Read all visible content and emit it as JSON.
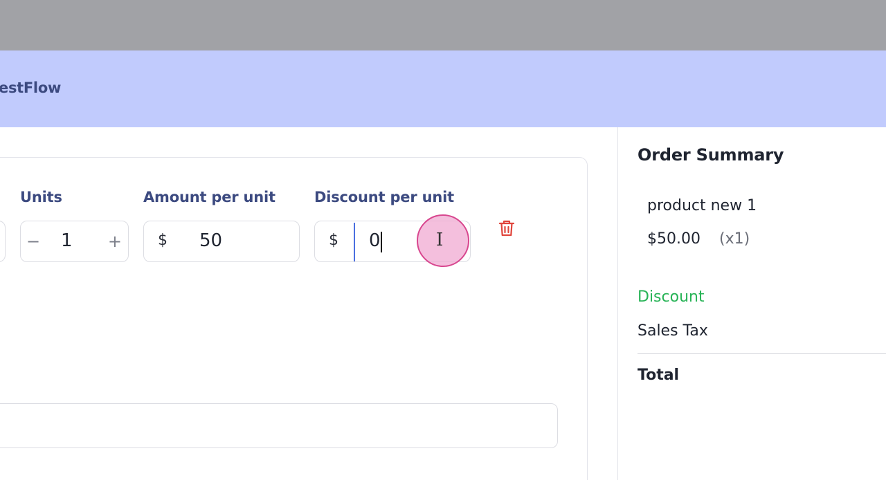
{
  "header": {
    "brand": "estFlow"
  },
  "line_item": {
    "units_label": "Units",
    "amount_label": "Amount per unit",
    "discount_label": "Discount per unit",
    "units_value": "1",
    "minus_symbol": "−",
    "plus_symbol": "+",
    "currency_symbol": "$",
    "amount_value": "50",
    "discount_value": "0",
    "delete_icon": "trash-icon"
  },
  "summary": {
    "title": "Order Summary",
    "item_name": "product new 1",
    "item_price": "$50.00",
    "item_qty": "(x1)",
    "discount_label": "Discount",
    "tax_label": "Sales Tax",
    "total_label": "Total"
  },
  "colors": {
    "header_bg": "#c1cbfd",
    "brand_text": "#3c4a80",
    "discount_green": "#27b356",
    "delete_red": "#e0453c",
    "focus_blue": "#4a6fe0"
  }
}
